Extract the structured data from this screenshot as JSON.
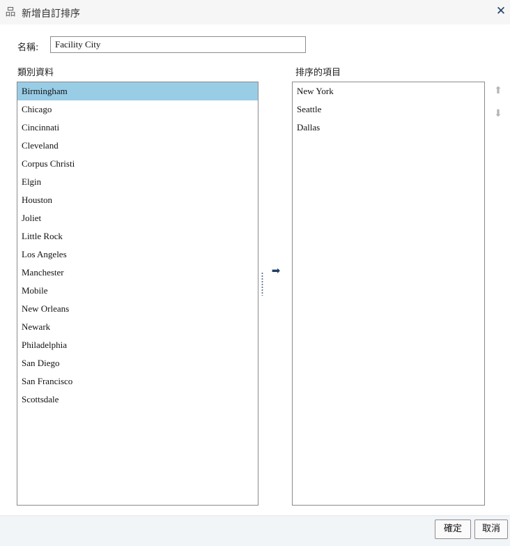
{
  "dialog": {
    "title": "新增自訂排序",
    "title_icon": "hierarchy-icon",
    "close_symbol": "✕"
  },
  "name_field": {
    "label": "名稱:",
    "value": "Facility City"
  },
  "category_list": {
    "label": "類別資料",
    "selected_index": 0,
    "items": [
      "Birmingham",
      "Chicago",
      "Cincinnati",
      "Cleveland",
      "Corpus Christi",
      "Elgin",
      "Houston",
      "Joliet",
      "Little Rock",
      "Los Angeles",
      "Manchester",
      "Mobile",
      "New Orleans",
      "Newark",
      "Philadelphia",
      "San Diego",
      "San Francisco",
      "Scottsdale"
    ]
  },
  "sorted_list": {
    "label": "排序的項目",
    "items": [
      "New York",
      "Seattle",
      "Dallas"
    ]
  },
  "controls": {
    "move_right_icon": "➡",
    "move_up_icon": "⬆",
    "move_down_icon": "⬇"
  },
  "footer": {
    "ok_label": "確定",
    "cancel_label": "取消"
  },
  "colors": {
    "selected_row": "#99cde6",
    "accent": "#1f3f66"
  }
}
